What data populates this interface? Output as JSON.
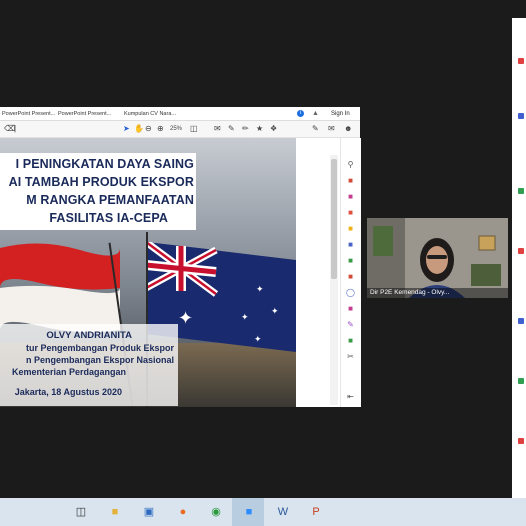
{
  "browser": {
    "tabs": [
      "PowerPoint Present...",
      "PowerPoint Present...",
      "Kumpulan CV Nara..."
    ],
    "info_icon_glyph": "i",
    "sign_in_label": "Sign In",
    "zoom_level": "25%"
  },
  "slide": {
    "title_lines": [
      "I PENINGKATAN DAYA SAING",
      "AI TAMBAH PRODUK EKSPOR",
      "M RANGKA PEMANFAATAN",
      "FASILITAS IA-CEPA"
    ],
    "speaker_name": "OLVY ANDRIANITA",
    "speaker_role_1": "tur Pengembangan Produk Ekspor",
    "speaker_role_2": "n Pengembangan Ekspor Nasional",
    "speaker_org": "Kementerian Perdagangan",
    "place_date": "Jakarta, 18 Agustus 2020"
  },
  "participant": {
    "caption": "Dir P2E Kemendag - Olvy..."
  },
  "colors": {
    "title_text": "#1a2a5a",
    "taskbar": "#d9e4ef",
    "accent_blue": "#1d6fe0"
  },
  "icons": {
    "side_tools": [
      "search-icon",
      "export-pdf-icon",
      "edit-pdf-icon",
      "create-pdf-icon",
      "comment-icon",
      "combine-files-icon",
      "organize-pages-icon",
      "redact-icon",
      "protect-icon",
      "optimize-icon",
      "fill-sign-icon",
      "send-icon",
      "more-tools-icon"
    ],
    "taskbar": [
      "task-view-icon",
      "file-explorer-icon",
      "store-icon",
      "firefox-icon",
      "zoom-icon",
      "chrome-icon",
      "zoom-app-icon",
      "word-icon",
      "powerpoint-icon"
    ]
  }
}
